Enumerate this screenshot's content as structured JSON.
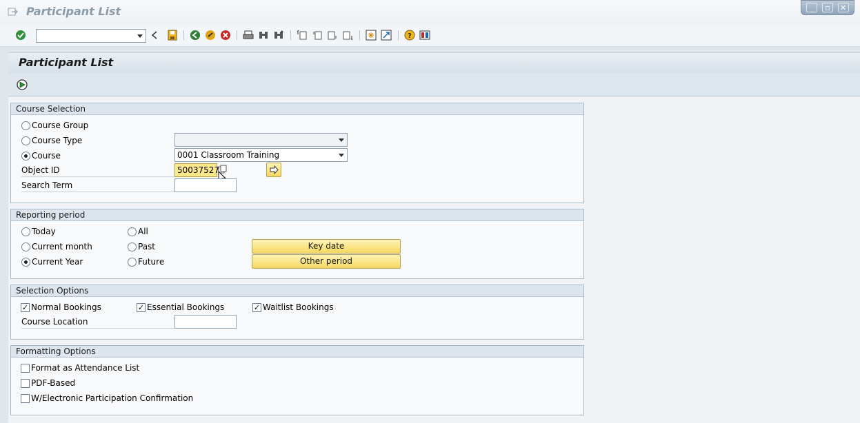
{
  "window": {
    "title": "Participant List"
  },
  "toolbar": {
    "command_field_value": "",
    "icons": [
      "enter-icon",
      "back-icon",
      "save-icon",
      "back-nav-icon",
      "exit-icon",
      "cancel-icon",
      "print-icon",
      "find-icon",
      "find-next-icon",
      "first-page-icon",
      "previous-page-icon",
      "next-page-icon",
      "last-page-icon",
      "create-session-icon",
      "create-shortcut-icon",
      "help-icon",
      "customize-layout-icon"
    ]
  },
  "page": {
    "title": "Participant List"
  },
  "course_selection": {
    "title": "Course Selection",
    "course_group_label": "Course Group",
    "course_type_label": "Course Type",
    "course_type_value": "",
    "course_label": "Course",
    "course_value": "0001 Classroom Training",
    "object_id_label": "Object ID",
    "object_id_value": "50037527",
    "search_term_label": "Search Term",
    "search_term_value": "",
    "selected": "Course"
  },
  "reporting_period": {
    "title": "Reporting period",
    "today_label": "Today",
    "current_month_label": "Current month",
    "current_year_label": "Current Year",
    "all_label": "All",
    "past_label": "Past",
    "future_label": "Future",
    "selected": "Current Year",
    "key_date_button": "Key date",
    "other_period_button": "Other period"
  },
  "selection_options": {
    "title": "Selection Options",
    "normal_bookings_label": "Normal Bookings",
    "essential_bookings_label": "Essential Bookings",
    "waitlist_bookings_label": "Waitlist Bookings",
    "course_location_label": "Course Location",
    "course_location_value": ""
  },
  "formatting_options": {
    "title": "Formatting Options",
    "attendance_list_label": "Format as Attendance List",
    "pdf_based_label": "PDF-Based",
    "electronic_confirmation_label": "W/Electronic Participation Confirmation"
  },
  "checkmark": "✓"
}
